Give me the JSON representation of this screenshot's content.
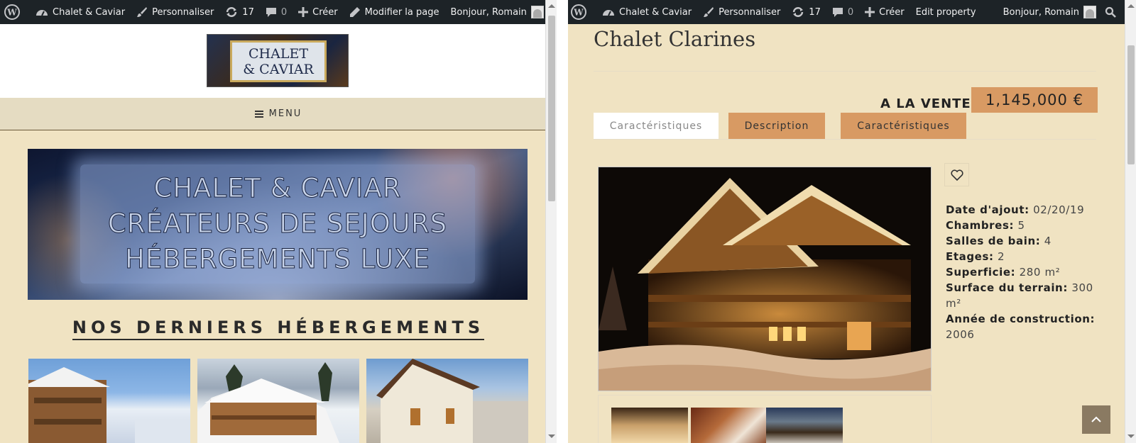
{
  "left_window": {
    "admin_bar": {
      "site_name": "Chalet & Caviar",
      "customize": "Personnaliser",
      "updates_count": "17",
      "comments_count": "0",
      "new_label": "Créer",
      "edit_label": "Modifier la page",
      "greeting": "Bonjour, Romain"
    },
    "logo": {
      "line1": "CHALET",
      "line2": "& CAVIAR"
    },
    "menu_label": "MENU",
    "banner": {
      "line1": "CHALET & CAVIAR",
      "line2": "CRÉATEURS DE SEJOURS",
      "line3": "HÉBERGEMENTS LUXE"
    },
    "section_title": "NOS DERNIERS HÉBERGEMENTS"
  },
  "right_window": {
    "admin_bar": {
      "site_name": "Chalet & Caviar",
      "customize": "Personnaliser",
      "updates_count": "17",
      "comments_count": "0",
      "new_label": "Créer",
      "edit_label": "Edit property",
      "greeting": "Bonjour, Romain"
    },
    "property": {
      "title": "Chalet Clarines",
      "sale_label": "A LA VENTE",
      "price": "1,145,000 €",
      "tabs": [
        "Caractéristiques",
        "Description",
        "Caractéristiques"
      ],
      "details": [
        {
          "label": "Date d'ajout:",
          "value": "02/20/19"
        },
        {
          "label": "Chambres:",
          "value": "5"
        },
        {
          "label": "Salles de bain:",
          "value": "4"
        },
        {
          "label": "Etages:",
          "value": "2"
        },
        {
          "label": "Superficie:",
          "value": "280 m²"
        },
        {
          "label": "Surface du terrain:",
          "value": "300 m²"
        },
        {
          "label": "Année de construction:",
          "value": "2006"
        }
      ]
    }
  },
  "colors": {
    "admin_bar": "#1d2327",
    "page_bg": "#f0e3c2",
    "accent": "#d89a63",
    "menu_bg": "#e5dcc2",
    "to_top": "#8a7a62"
  },
  "icons": [
    "wordpress-icon",
    "dashboard-icon",
    "brush-icon",
    "updates-icon",
    "comment-icon",
    "plus-icon",
    "pencil-icon",
    "search-icon",
    "heart-icon",
    "chevron-up-icon",
    "menu-icon"
  ]
}
